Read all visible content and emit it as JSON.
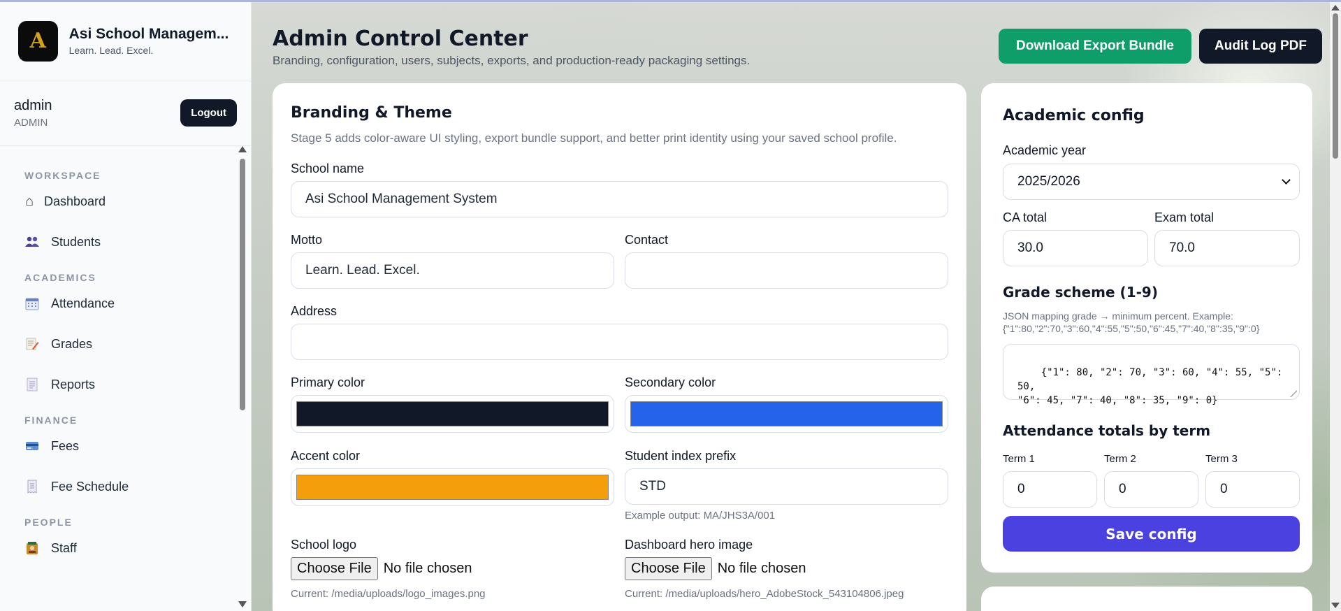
{
  "brand": {
    "name": "Asi School Managem...",
    "motto": "Learn. Lead. Excel.",
    "logo_letter": "A"
  },
  "user": {
    "name": "admin",
    "role": "ADMIN",
    "logout_label": "Logout"
  },
  "nav": {
    "sections": [
      {
        "title": "WORKSPACE",
        "items": [
          {
            "label": "Dashboard",
            "icon": "home-icon"
          },
          {
            "label": "Students",
            "icon": "students-icon"
          }
        ]
      },
      {
        "title": "ACADEMICS",
        "items": [
          {
            "label": "Attendance",
            "icon": "calendar-icon"
          },
          {
            "label": "Grades",
            "icon": "memo-icon"
          },
          {
            "label": "Reports",
            "icon": "document-icon"
          }
        ]
      },
      {
        "title": "FINANCE",
        "items": [
          {
            "label": "Fees",
            "icon": "credit-card-icon"
          },
          {
            "label": "Fee Schedule",
            "icon": "receipt-icon"
          }
        ]
      },
      {
        "title": "PEOPLE",
        "items": [
          {
            "label": "Staff",
            "icon": "staff-icon"
          }
        ]
      }
    ]
  },
  "header": {
    "title": "Admin Control Center",
    "subtitle": "Branding, configuration, users, subjects, exports, and production-ready packaging settings.",
    "export_button": "Download Export Bundle",
    "audit_button": "Audit Log PDF"
  },
  "branding": {
    "title": "Branding & Theme",
    "description": "Stage 5 adds color-aware UI styling, export bundle support, and better print identity using your saved school profile.",
    "school_name_label": "School name",
    "school_name_value": "Asi School Management System",
    "motto_label": "Motto",
    "motto_value": "Learn. Lead. Excel.",
    "contact_label": "Contact",
    "contact_value": "",
    "address_label": "Address",
    "address_value": "",
    "primary_label": "Primary color",
    "primary_color": "#111827",
    "secondary_label": "Secondary color",
    "secondary_color": "#2563eb",
    "accent_label": "Accent color",
    "accent_color": "#f59e0b",
    "index_prefix_label": "Student index prefix",
    "index_prefix_value": "STD",
    "index_prefix_hint": "Example output: MA/JHS3A/001",
    "logo_label": "School logo",
    "hero_label": "Dashboard hero image",
    "choose_file": "Choose File",
    "no_file": "No file chosen",
    "current_label": "Current:",
    "logo_current": "/media/uploads/logo_images.png",
    "hero_current": "/media/uploads/hero_AdobeStock_543104806.jpeg"
  },
  "academic": {
    "title": "Academic config",
    "year_label": "Academic year",
    "year_value": "2025/2026",
    "ca_label": "CA total",
    "ca_value": "30.0",
    "exam_label": "Exam total",
    "exam_value": "70.0",
    "grade_heading": "Grade scheme (1-9)",
    "grade_hint_1": "JSON mapping grade → minimum percent. Example:",
    "grade_hint_2": "{\"1\":80,\"2\":70,\"3\":60,\"4\":55,\"5\":50,\"6\":45,\"7\":40,\"8\":35,\"9\":0}",
    "grade_value": "{\"1\": 80, \"2\": 70, \"3\": 60, \"4\": 55, \"5\": 50,\n\"6\": 45, \"7\": 40, \"8\": 35, \"9\": 0}",
    "attendance_heading": "Attendance totals by term",
    "term1_label": "Term 1",
    "term1_value": "0",
    "term2_label": "Term 2",
    "term2_value": "0",
    "term3_label": "Term 3",
    "term3_value": "0",
    "save_label": "Save config"
  }
}
